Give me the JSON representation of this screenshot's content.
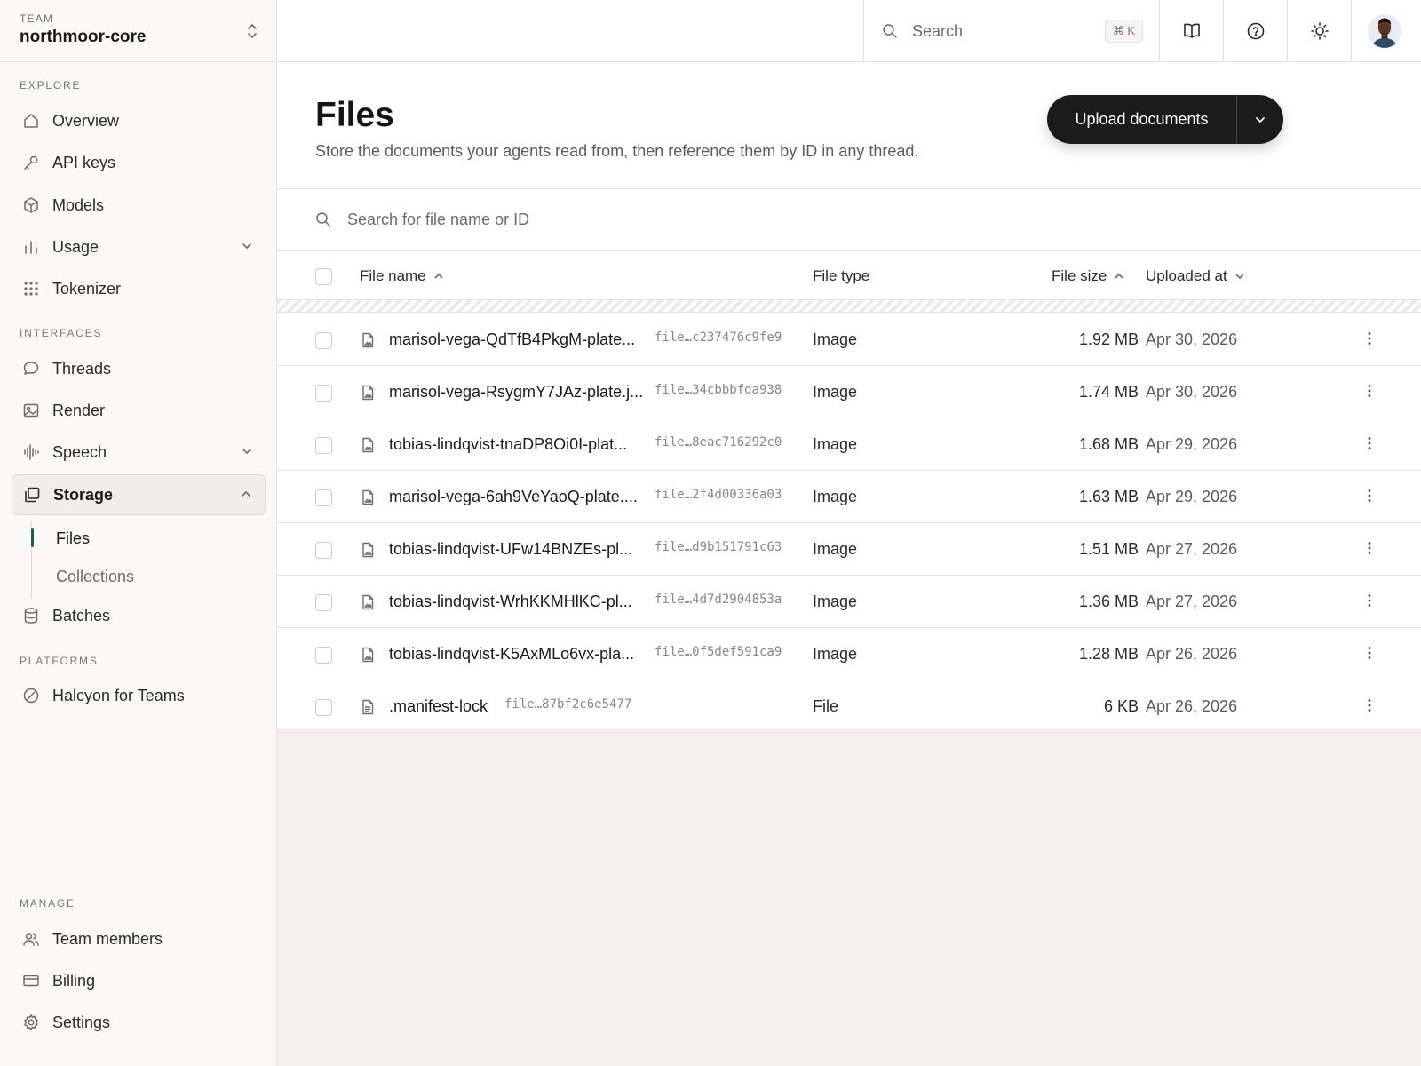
{
  "team": {
    "label": "TEAM",
    "name": "northmoor-core"
  },
  "sidebar": {
    "explore_label": "EXPLORE",
    "interfaces_label": "INTERFACES",
    "platforms_label": "PLATFORMS",
    "manage_label": "MANAGE",
    "items": {
      "overview": "Overview",
      "api_keys": "API keys",
      "models": "Models",
      "usage": "Usage",
      "tokenizer": "Tokenizer",
      "threads": "Threads",
      "render": "Render",
      "speech": "Speech",
      "storage": "Storage",
      "files": "Files",
      "collections": "Collections",
      "batches": "Batches",
      "halcyon": "Halcyon for Teams",
      "team_members": "Team members",
      "billing": "Billing",
      "settings": "Settings"
    }
  },
  "topbar": {
    "search_placeholder": "Search",
    "shortcut": "⌘ K",
    "icons": [
      "book-icon",
      "help-icon",
      "sun-icon"
    ]
  },
  "page": {
    "title": "Files",
    "subtitle": "Store the documents your agents read from, then reference them by ID in any thread.",
    "upload_label": "Upload documents",
    "search_placeholder": "Search for file name or ID"
  },
  "table": {
    "columns": {
      "name": "File name",
      "type": "File type",
      "size": "File size",
      "uploaded": "Uploaded at"
    },
    "rows": [
      {
        "name": "marisol-vega-QdTfB4PkgM-plate...",
        "id": "file…c237476c9fe9",
        "type": "Image",
        "size": "1.92 MB",
        "date": "Apr 30, 2026",
        "icon": "image-file-icon"
      },
      {
        "name": "marisol-vega-RsygmY7JAz-plate.j...",
        "id": "file…34cbbbfda938",
        "type": "Image",
        "size": "1.74 MB",
        "date": "Apr 30, 2026",
        "icon": "image-file-icon"
      },
      {
        "name": "tobias-lindqvist-tnaDP8Oi0I-plat...",
        "id": "file…8eac716292c0",
        "type": "Image",
        "size": "1.68 MB",
        "date": "Apr 29, 2026",
        "icon": "image-file-icon"
      },
      {
        "name": "marisol-vega-6ah9VeYaoQ-plate....",
        "id": "file…2f4d00336a03",
        "type": "Image",
        "size": "1.63 MB",
        "date": "Apr 29, 2026",
        "icon": "image-file-icon"
      },
      {
        "name": "tobias-lindqvist-UFw14BNZEs-pl...",
        "id": "file…d9b151791c63",
        "type": "Image",
        "size": "1.51 MB",
        "date": "Apr 27, 2026",
        "icon": "image-file-icon"
      },
      {
        "name": "tobias-lindqvist-WrhKKMHlKC-pl...",
        "id": "file…4d7d2904853a",
        "type": "Image",
        "size": "1.36 MB",
        "date": "Apr 27, 2026",
        "icon": "image-file-icon"
      },
      {
        "name": "tobias-lindqvist-K5AxMLo6vx-pla...",
        "id": "file…0f5def591ca9",
        "type": "Image",
        "size": "1.28 MB",
        "date": "Apr 26, 2026",
        "icon": "image-file-icon"
      },
      {
        "name": ".manifest-lock",
        "id": "file…87bf2c6e5477",
        "type": "File",
        "size": "6 KB",
        "date": "Apr 26, 2026",
        "icon": "document-file-icon"
      }
    ]
  },
  "colors": {
    "accent": "#1f5c4b",
    "button": "#1b1b1b"
  }
}
